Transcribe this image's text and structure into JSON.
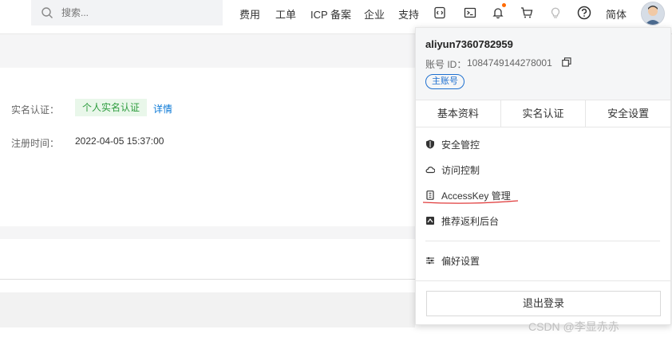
{
  "header": {
    "search_placeholder": "搜索...",
    "links": [
      "费用",
      "工单",
      "ICP 备案",
      "企业",
      "支持"
    ],
    "language": "简体",
    "icons": [
      "terminal-code-icon",
      "console-icon",
      "bell-icon",
      "cart-icon",
      "bulb-icon",
      "help-icon"
    ],
    "accent_color": "#ff6a00"
  },
  "profile": {
    "verify_label": "实名认证：",
    "verify_value": "个人实名认证",
    "verify_link": "详情",
    "register_label": "注册时间：",
    "register_value": "2022-04-05 15:37:00"
  },
  "dropdown": {
    "username": "aliyun7360782959",
    "id_label": "账号 ID：",
    "id_value": "1084749144278001",
    "badge": "主账号",
    "tabs": [
      "基本资料",
      "实名认证",
      "安全设置"
    ],
    "menu": [
      "安全管控",
      "访问控制",
      "AccessKey 管理",
      "推荐返利后台"
    ],
    "preferences": "偏好设置",
    "logout": "退出登录"
  },
  "watermark": "CSDN @李显赤赤"
}
